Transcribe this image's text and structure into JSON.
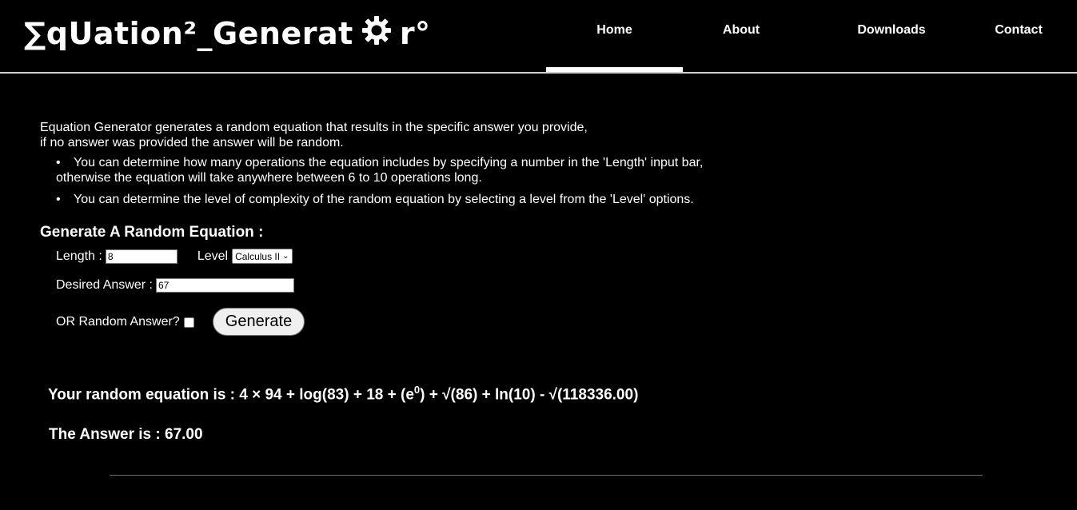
{
  "header": {
    "logo_part1": "∑qᑌation²_Generat",
    "logo_part2": "r°",
    "nav": [
      {
        "label": "Home",
        "active": true
      },
      {
        "label": "About",
        "active": false
      },
      {
        "label": "Downloads",
        "active": false
      },
      {
        "label": "Contact",
        "active": false
      }
    ]
  },
  "intro": {
    "line1": "Equation Generator generates a random equation that results in the specific answer you provide,",
    "line2": "if no answer was provided the answer will be random.",
    "bullets": [
      {
        "line1": "You can determine how many operations the equation includes by specifying a number in the 'Length' input bar,",
        "line2": "otherwise the equation will take anywhere between 6 to 10 operations long."
      },
      {
        "line1": "You can determine the level of complexity of the random equation by selecting a level from the 'Level' options.",
        "line2": ""
      }
    ]
  },
  "form": {
    "title": "Generate A Random Equation :",
    "length_label": "Length :",
    "length_value": "8",
    "level_label": "Level",
    "level_selected": "Calculus II",
    "desired_label": "Desired Answer :",
    "desired_value": "67",
    "random_label": "OR Random Answer?",
    "random_checked": false,
    "generate_label": "Generate"
  },
  "result": {
    "equation_prefix": "Your random equation is : 4 × 94 + log(83) + 18 + (e",
    "equation_exponent": "0",
    "equation_suffix": ") + √(86) + ln(10) - √(118336.00)",
    "answer": "The Answer is : 67.00"
  },
  "colors": {
    "background": "#000000",
    "text": "#ffffff",
    "nav_underline": "#ffffff",
    "button_bg": "#efefef"
  }
}
